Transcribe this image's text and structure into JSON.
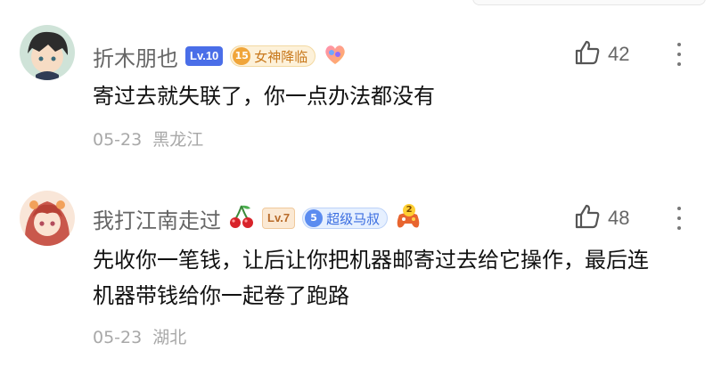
{
  "comments": [
    {
      "username": "折木朋也",
      "level": "Lv.10",
      "fan_level": "15",
      "fan_title": "女神降临",
      "text": "寄过去就失联了，你一点办法都没有",
      "date": "05-23",
      "location": "黑龙江",
      "likes": "42"
    },
    {
      "username": "我打江南走过",
      "level": "Lv.7",
      "fan_level": "5",
      "fan_title": "超级马叔",
      "extra_badge": "2",
      "text_lines": [
        "先收你一笔钱，让后让你把机器邮寄过去给它操作，最后连",
        "机器带钱给你一起卷了跑路"
      ],
      "date": "05-23",
      "location": "湖北",
      "likes": "48"
    }
  ],
  "icons": {
    "like": "thumbs-up-icon",
    "more": "more-vertical-icon",
    "cherry": "cherry-icon",
    "heart_badge": "heart-badge-icon",
    "game_badge": "gamepad-icon"
  },
  "colors": {
    "username": "#666666",
    "body": "#111111",
    "meta": "#a8a8a8",
    "lv10": "#4a6ee8",
    "fan_gold": "#c8781b",
    "fan_blue": "#3a6de0"
  }
}
